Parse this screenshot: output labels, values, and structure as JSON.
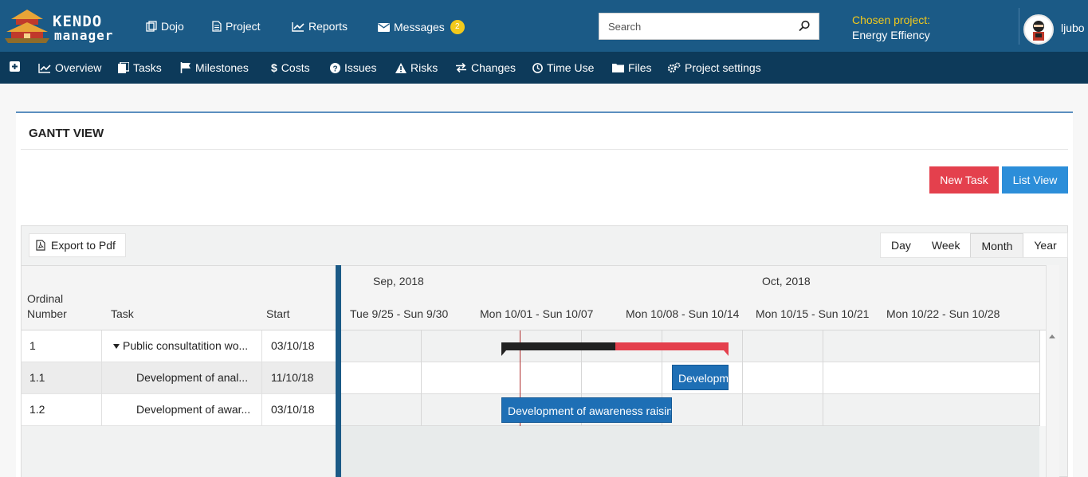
{
  "brand": {
    "logo_text_line1": "KENDO",
    "logo_text_line2": "manager"
  },
  "topnav": {
    "items": [
      {
        "label": "Dojo",
        "icon": "copy-icon"
      },
      {
        "label": "Project",
        "icon": "document-icon"
      },
      {
        "label": "Reports",
        "icon": "line-chart-icon"
      },
      {
        "label": "Messages",
        "icon": "envelope-icon",
        "badge": "2"
      }
    ],
    "search_placeholder": "Search",
    "chosen_project_label": "Chosen project:",
    "chosen_project_name": "Energy Effiency",
    "username": "ljubo"
  },
  "subnav": {
    "items": [
      {
        "label": "Overview",
        "icon": "area-chart-icon"
      },
      {
        "label": "Tasks",
        "icon": "tasks-icon"
      },
      {
        "label": "Milestones",
        "icon": "flag-icon"
      },
      {
        "label": "Costs",
        "icon": "dollar-icon"
      },
      {
        "label": "Issues",
        "icon": "question-icon"
      },
      {
        "label": "Risks",
        "icon": "warning-icon"
      },
      {
        "label": "Changes",
        "icon": "exchange-icon"
      },
      {
        "label": "Time Use",
        "icon": "clock-icon"
      },
      {
        "label": "Files",
        "icon": "folder-icon"
      },
      {
        "label": "Project settings",
        "icon": "cogs-icon"
      }
    ]
  },
  "panel": {
    "title": "GANTT VIEW",
    "new_task_label": "New Task",
    "list_view_label": "List View"
  },
  "gantt": {
    "export_label": "Export to Pdf",
    "views": [
      "Day",
      "Week",
      "Month",
      "Year"
    ],
    "active_view": "Month",
    "columns": {
      "ordinal_line1": "Ordinal",
      "ordinal_line2": "Number",
      "task": "Task",
      "start": "Start"
    },
    "rows": [
      {
        "ordinal": "1",
        "task": "Public consultatition wo...",
        "start": "03/10/18",
        "summary": true
      },
      {
        "ordinal": "1.1",
        "task": "Development of anal...",
        "start": "11/10/18",
        "summary": false
      },
      {
        "ordinal": "1.2",
        "task": "Development of awar...",
        "start": "03/10/18",
        "summary": false
      }
    ],
    "months": [
      "Sep, 2018",
      "Oct, 2018"
    ],
    "weeks": [
      "Tue 9/25 - Sun 9/30",
      "Mon 10/01 - Sun 10/07",
      "Mon 10/08 - Sun 10/14",
      "Mon 10/15 - Sun 10/21",
      "Mon 10/22 - Sun 10/28"
    ],
    "bars": [
      {
        "label": "Developm"
      },
      {
        "label": "Development of awareness raisin"
      }
    ],
    "colors": {
      "summary_done": "#222222",
      "summary_remaining": "#e4404d",
      "task_bar": "#1e6fb5",
      "today_line": "#b03030"
    }
  }
}
